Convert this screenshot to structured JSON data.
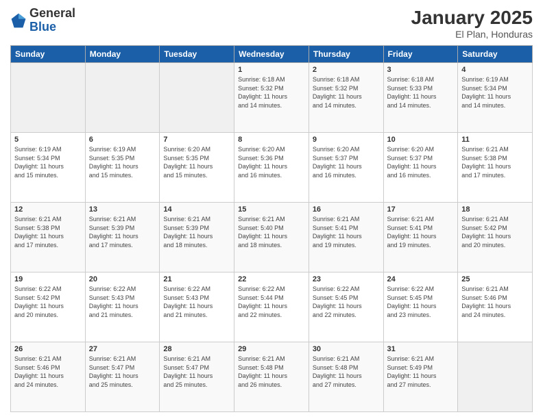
{
  "header": {
    "logo_general": "General",
    "logo_blue": "Blue",
    "month_title": "January 2025",
    "location": "El Plan, Honduras"
  },
  "days_of_week": [
    "Sunday",
    "Monday",
    "Tuesday",
    "Wednesday",
    "Thursday",
    "Friday",
    "Saturday"
  ],
  "weeks": [
    [
      {
        "day": "",
        "info": ""
      },
      {
        "day": "",
        "info": ""
      },
      {
        "day": "",
        "info": ""
      },
      {
        "day": "1",
        "info": "Sunrise: 6:18 AM\nSunset: 5:32 PM\nDaylight: 11 hours\nand 14 minutes."
      },
      {
        "day": "2",
        "info": "Sunrise: 6:18 AM\nSunset: 5:32 PM\nDaylight: 11 hours\nand 14 minutes."
      },
      {
        "day": "3",
        "info": "Sunrise: 6:18 AM\nSunset: 5:33 PM\nDaylight: 11 hours\nand 14 minutes."
      },
      {
        "day": "4",
        "info": "Sunrise: 6:19 AM\nSunset: 5:34 PM\nDaylight: 11 hours\nand 14 minutes."
      }
    ],
    [
      {
        "day": "5",
        "info": "Sunrise: 6:19 AM\nSunset: 5:34 PM\nDaylight: 11 hours\nand 15 minutes."
      },
      {
        "day": "6",
        "info": "Sunrise: 6:19 AM\nSunset: 5:35 PM\nDaylight: 11 hours\nand 15 minutes."
      },
      {
        "day": "7",
        "info": "Sunrise: 6:20 AM\nSunset: 5:35 PM\nDaylight: 11 hours\nand 15 minutes."
      },
      {
        "day": "8",
        "info": "Sunrise: 6:20 AM\nSunset: 5:36 PM\nDaylight: 11 hours\nand 16 minutes."
      },
      {
        "day": "9",
        "info": "Sunrise: 6:20 AM\nSunset: 5:37 PM\nDaylight: 11 hours\nand 16 minutes."
      },
      {
        "day": "10",
        "info": "Sunrise: 6:20 AM\nSunset: 5:37 PM\nDaylight: 11 hours\nand 16 minutes."
      },
      {
        "day": "11",
        "info": "Sunrise: 6:21 AM\nSunset: 5:38 PM\nDaylight: 11 hours\nand 17 minutes."
      }
    ],
    [
      {
        "day": "12",
        "info": "Sunrise: 6:21 AM\nSunset: 5:38 PM\nDaylight: 11 hours\nand 17 minutes."
      },
      {
        "day": "13",
        "info": "Sunrise: 6:21 AM\nSunset: 5:39 PM\nDaylight: 11 hours\nand 17 minutes."
      },
      {
        "day": "14",
        "info": "Sunrise: 6:21 AM\nSunset: 5:39 PM\nDaylight: 11 hours\nand 18 minutes."
      },
      {
        "day": "15",
        "info": "Sunrise: 6:21 AM\nSunset: 5:40 PM\nDaylight: 11 hours\nand 18 minutes."
      },
      {
        "day": "16",
        "info": "Sunrise: 6:21 AM\nSunset: 5:41 PM\nDaylight: 11 hours\nand 19 minutes."
      },
      {
        "day": "17",
        "info": "Sunrise: 6:21 AM\nSunset: 5:41 PM\nDaylight: 11 hours\nand 19 minutes."
      },
      {
        "day": "18",
        "info": "Sunrise: 6:21 AM\nSunset: 5:42 PM\nDaylight: 11 hours\nand 20 minutes."
      }
    ],
    [
      {
        "day": "19",
        "info": "Sunrise: 6:22 AM\nSunset: 5:42 PM\nDaylight: 11 hours\nand 20 minutes."
      },
      {
        "day": "20",
        "info": "Sunrise: 6:22 AM\nSunset: 5:43 PM\nDaylight: 11 hours\nand 21 minutes."
      },
      {
        "day": "21",
        "info": "Sunrise: 6:22 AM\nSunset: 5:43 PM\nDaylight: 11 hours\nand 21 minutes."
      },
      {
        "day": "22",
        "info": "Sunrise: 6:22 AM\nSunset: 5:44 PM\nDaylight: 11 hours\nand 22 minutes."
      },
      {
        "day": "23",
        "info": "Sunrise: 6:22 AM\nSunset: 5:45 PM\nDaylight: 11 hours\nand 22 minutes."
      },
      {
        "day": "24",
        "info": "Sunrise: 6:22 AM\nSunset: 5:45 PM\nDaylight: 11 hours\nand 23 minutes."
      },
      {
        "day": "25",
        "info": "Sunrise: 6:21 AM\nSunset: 5:46 PM\nDaylight: 11 hours\nand 24 minutes."
      }
    ],
    [
      {
        "day": "26",
        "info": "Sunrise: 6:21 AM\nSunset: 5:46 PM\nDaylight: 11 hours\nand 24 minutes."
      },
      {
        "day": "27",
        "info": "Sunrise: 6:21 AM\nSunset: 5:47 PM\nDaylight: 11 hours\nand 25 minutes."
      },
      {
        "day": "28",
        "info": "Sunrise: 6:21 AM\nSunset: 5:47 PM\nDaylight: 11 hours\nand 25 minutes."
      },
      {
        "day": "29",
        "info": "Sunrise: 6:21 AM\nSunset: 5:48 PM\nDaylight: 11 hours\nand 26 minutes."
      },
      {
        "day": "30",
        "info": "Sunrise: 6:21 AM\nSunset: 5:48 PM\nDaylight: 11 hours\nand 27 minutes."
      },
      {
        "day": "31",
        "info": "Sunrise: 6:21 AM\nSunset: 5:49 PM\nDaylight: 11 hours\nand 27 minutes."
      },
      {
        "day": "",
        "info": ""
      }
    ]
  ]
}
